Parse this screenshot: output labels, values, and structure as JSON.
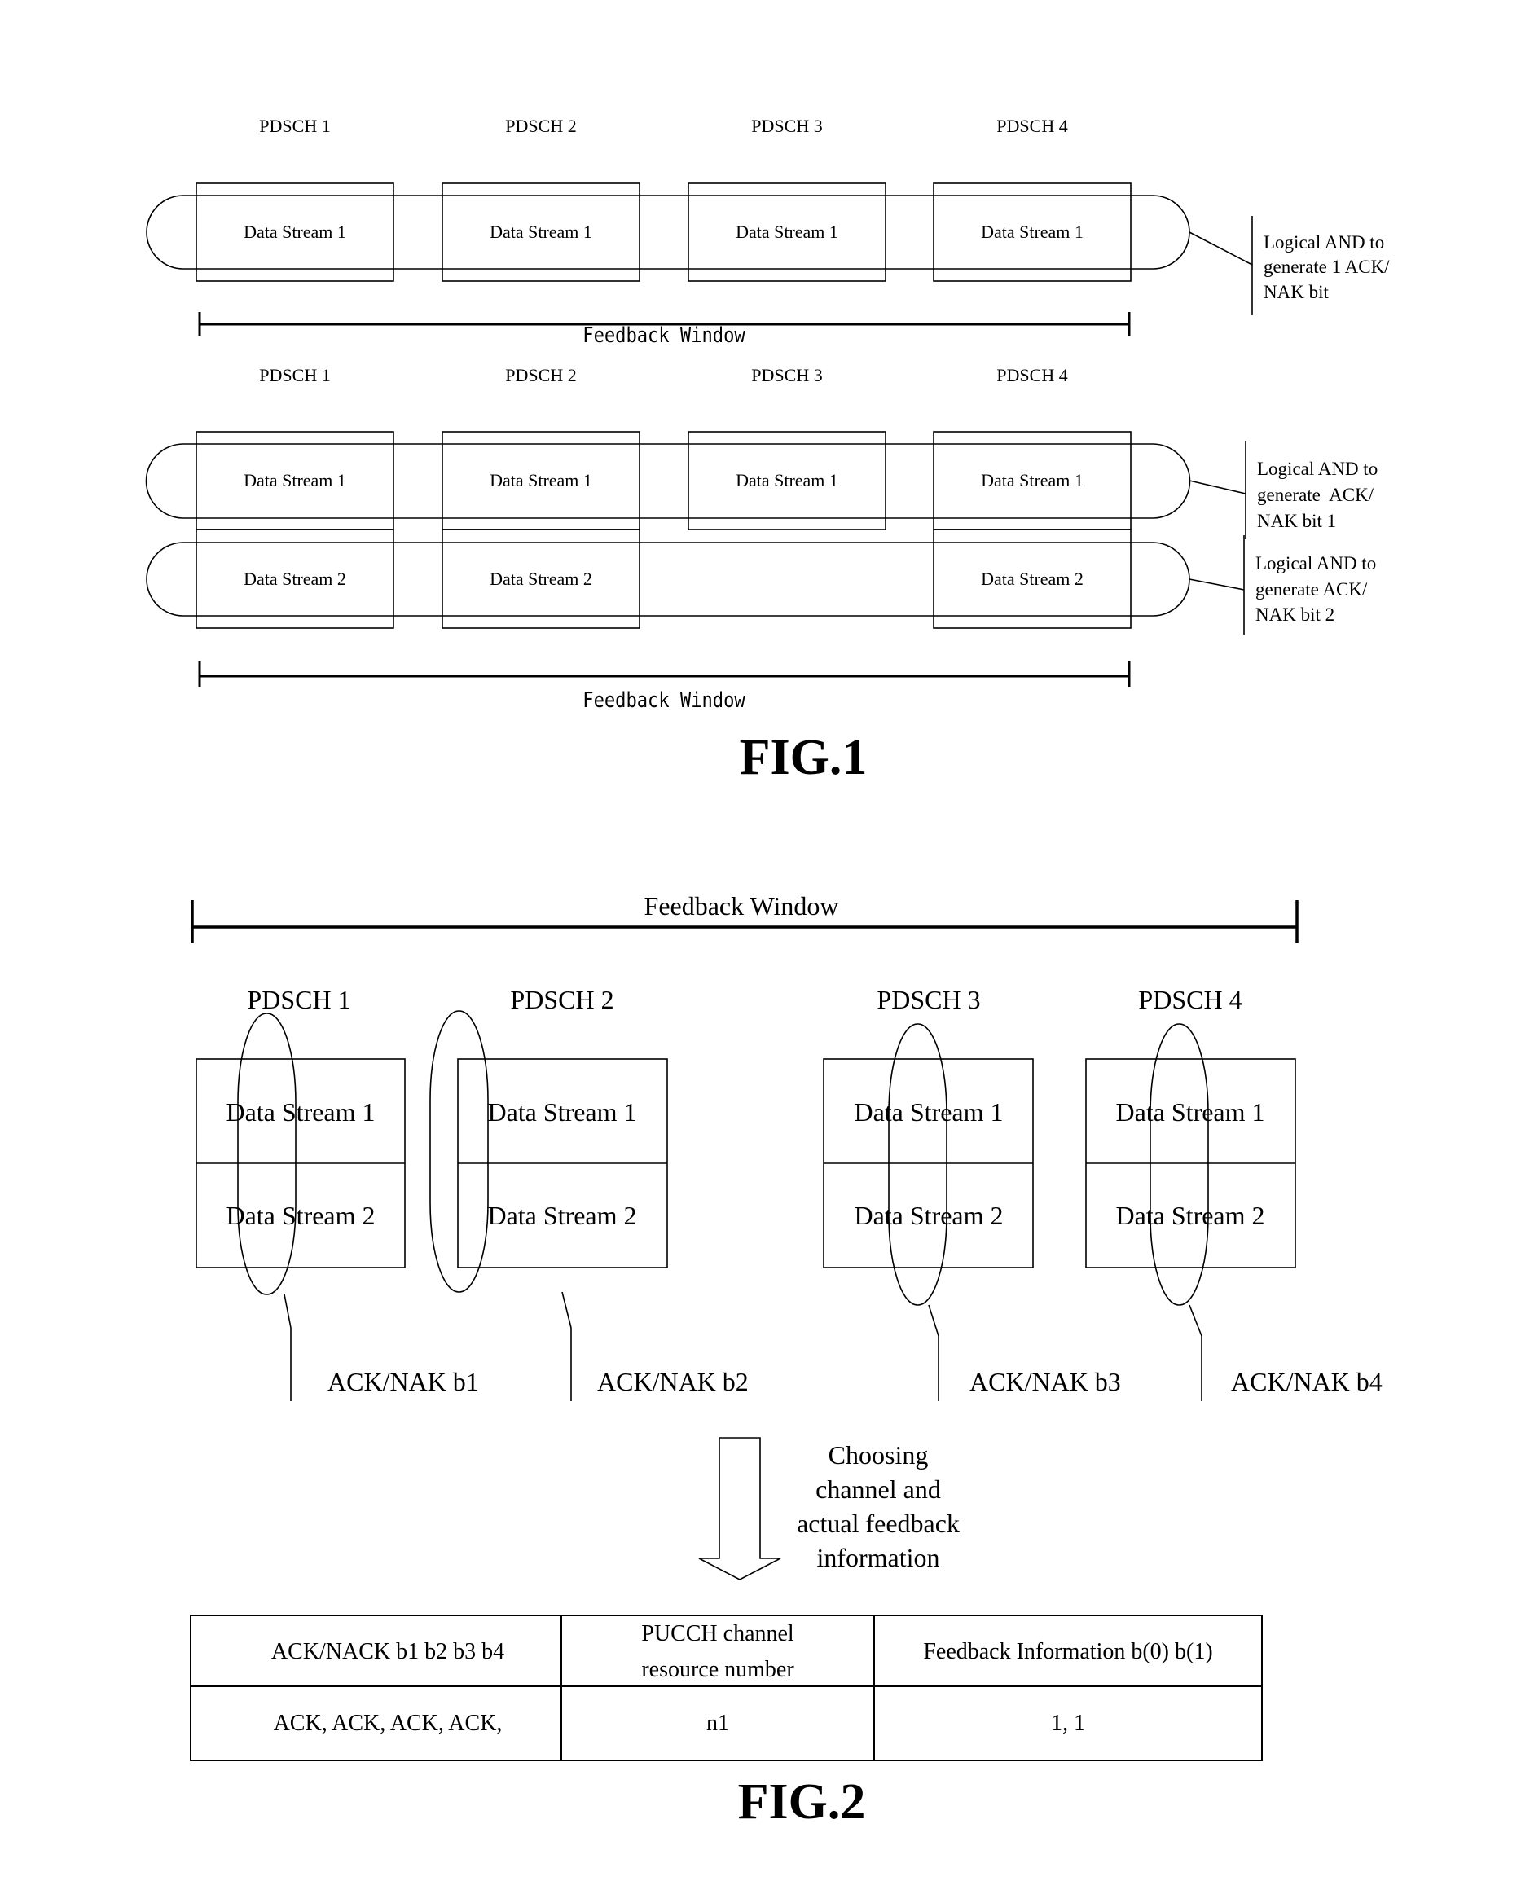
{
  "fig1": {
    "top": {
      "pdsch_labels": [
        "PDSCH 1",
        "PDSCH 2",
        "PDSCH 3",
        "PDSCH 4"
      ],
      "streams": [
        "Data Stream 1",
        "Data Stream 1",
        "Data Stream 1",
        "Data Stream 1"
      ],
      "feedback_window": "Feedback Window",
      "annotation": [
        "Logical AND to",
        "generate 1 ACK/",
        "NAK bit"
      ]
    },
    "bottom": {
      "pdsch_labels": [
        "PDSCH 1",
        "PDSCH 2",
        "PDSCH 3",
        "PDSCH 4"
      ],
      "row1": [
        "Data Stream 1",
        "Data Stream 1",
        "Data Stream 1",
        "Data Stream 1"
      ],
      "row2": [
        "Data Stream 2",
        "Data Stream 2",
        "",
        "Data Stream 2"
      ],
      "feedback_window": "Feedback Window",
      "annotation1": [
        "Logical AND to",
        "generate  ACK/",
        "NAK bit 1"
      ],
      "annotation2": [
        "Logical AND to",
        "generate ACK/",
        "NAK bit 2"
      ]
    },
    "caption": "FIG.1"
  },
  "fig2": {
    "feedback_window": "Feedback Window",
    "pdsch_labels": [
      "PDSCH 1",
      "PDSCH 2",
      "PDSCH 3",
      "PDSCH 4"
    ],
    "row1": [
      "Data Stream 1",
      "Data Stream 1",
      "Data Stream 1",
      "Data Stream 1"
    ],
    "row2": [
      "Data Stream 2",
      "Data Stream 2",
      "Data Stream 2",
      "Data Stream 2"
    ],
    "ack_labels": [
      "ACK/NAK b1",
      "ACK/NAK b2",
      "ACK/NAK b3",
      "ACK/NAK b4"
    ],
    "arrow_text": [
      "Choosing",
      "channel and",
      "actual feedback",
      "information"
    ],
    "table": {
      "headers": [
        "ACK/NACK b1 b2 b3 b4",
        [
          "PUCCH channel",
          "resource number"
        ],
        "Feedback Information b(0) b(1)"
      ],
      "rows": [
        [
          "ACK, ACK, ACK, ACK,",
          "n1",
          "1, 1"
        ]
      ]
    },
    "caption": "FIG.2"
  }
}
